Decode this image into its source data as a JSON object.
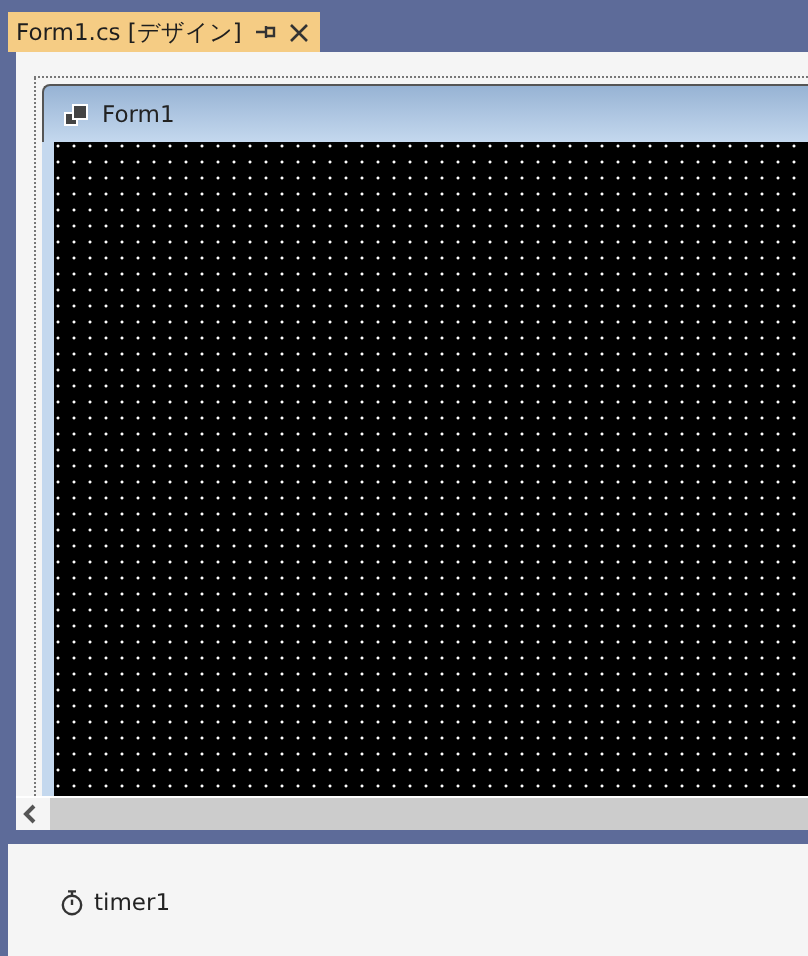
{
  "tab": {
    "title": "Form1.cs [デザイン]",
    "selected": true
  },
  "form": {
    "title": "Form1"
  },
  "component_tray": {
    "items": [
      {
        "name": "timer1"
      }
    ]
  }
}
